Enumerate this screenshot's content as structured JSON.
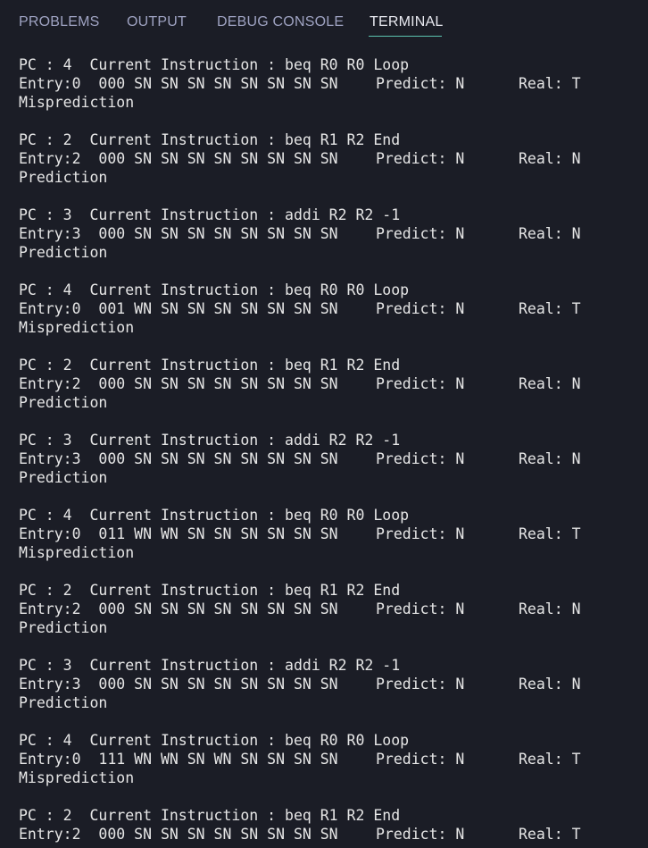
{
  "tabs": [
    {
      "label": "PROBLEMS",
      "active": false
    },
    {
      "label": "OUTPUT",
      "active": false
    },
    {
      "label": "DEBUG CONSOLE",
      "active": false
    },
    {
      "label": "TERMINAL",
      "active": true
    }
  ],
  "colors": {
    "background": "#1b1d26",
    "text": "#e6e6e6",
    "tab_inactive": "#9fa3c2",
    "tab_active": "#e8e9f0",
    "tab_underline": "#5bc4b0"
  },
  "terminal": {
    "entries": [
      {
        "pc_line": "PC : 4  Current Instruction : beq R0 R0 Loop",
        "entry": "Entry:0  000 SN SN SN SN SN SN SN SN",
        "predict": "Predict: N",
        "real": "Real: T",
        "result": "Misprediction"
      },
      {
        "pc_line": "PC : 2  Current Instruction : beq R1 R2 End",
        "entry": "Entry:2  000 SN SN SN SN SN SN SN SN",
        "predict": "Predict: N",
        "real": "Real: N",
        "result": "Prediction"
      },
      {
        "pc_line": "PC : 3  Current Instruction : addi R2 R2 -1",
        "entry": "Entry:3  000 SN SN SN SN SN SN SN SN",
        "predict": "Predict: N",
        "real": "Real: N",
        "result": "Prediction"
      },
      {
        "pc_line": "PC : 4  Current Instruction : beq R0 R0 Loop",
        "entry": "Entry:0  001 WN SN SN SN SN SN SN SN",
        "predict": "Predict: N",
        "real": "Real: T",
        "result": "Misprediction"
      },
      {
        "pc_line": "PC : 2  Current Instruction : beq R1 R2 End",
        "entry": "Entry:2  000 SN SN SN SN SN SN SN SN",
        "predict": "Predict: N",
        "real": "Real: N",
        "result": "Prediction"
      },
      {
        "pc_line": "PC : 3  Current Instruction : addi R2 R2 -1",
        "entry": "Entry:3  000 SN SN SN SN SN SN SN SN",
        "predict": "Predict: N",
        "real": "Real: N",
        "result": "Prediction"
      },
      {
        "pc_line": "PC : 4  Current Instruction : beq R0 R0 Loop",
        "entry": "Entry:0  011 WN WN SN SN SN SN SN SN",
        "predict": "Predict: N",
        "real": "Real: T",
        "result": "Misprediction"
      },
      {
        "pc_line": "PC : 2  Current Instruction : beq R1 R2 End",
        "entry": "Entry:2  000 SN SN SN SN SN SN SN SN",
        "predict": "Predict: N",
        "real": "Real: N",
        "result": "Prediction"
      },
      {
        "pc_line": "PC : 3  Current Instruction : addi R2 R2 -1",
        "entry": "Entry:3  000 SN SN SN SN SN SN SN SN",
        "predict": "Predict: N",
        "real": "Real: N",
        "result": "Prediction"
      },
      {
        "pc_line": "PC : 4  Current Instruction : beq R0 R0 Loop",
        "entry": "Entry:0  111 WN WN SN WN SN SN SN SN",
        "predict": "Predict: N",
        "real": "Real: T",
        "result": "Misprediction"
      },
      {
        "pc_line": "PC : 2  Current Instruction : beq R1 R2 End",
        "entry": "Entry:2  000 SN SN SN SN SN SN SN SN",
        "predict": "Predict: N",
        "real": "Real: T",
        "result": ""
      }
    ]
  }
}
